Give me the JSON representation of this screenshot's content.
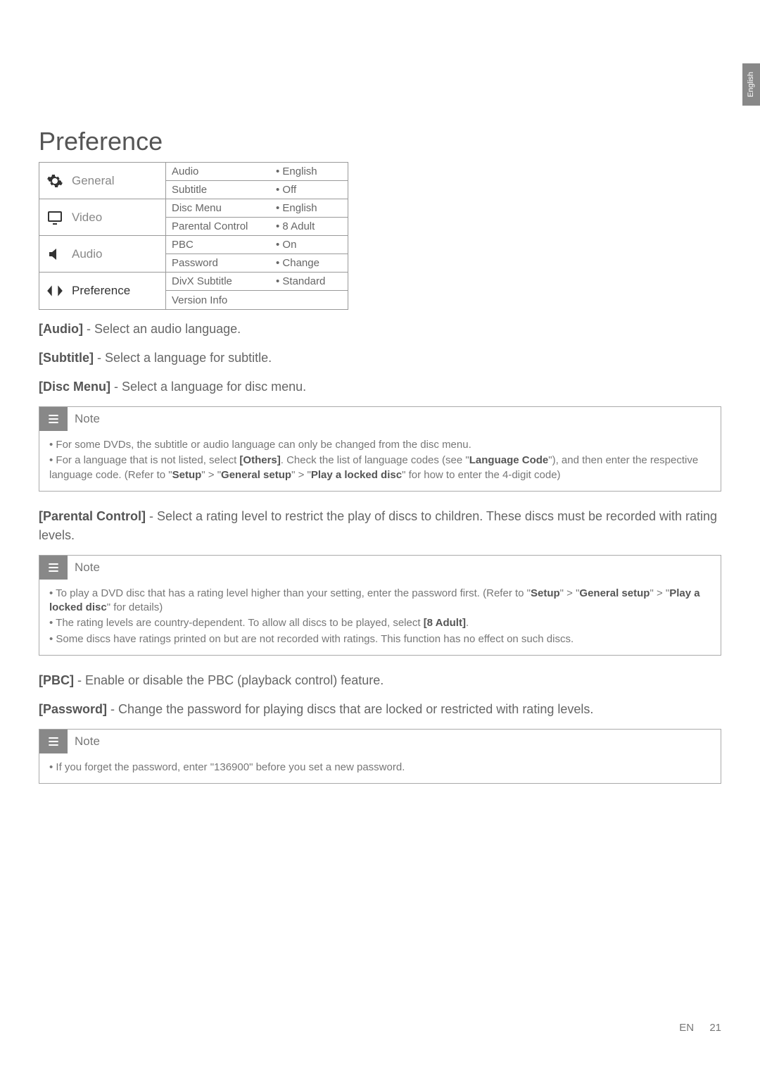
{
  "side_tab": "English",
  "heading": "Preference",
  "menu": {
    "items": [
      "General",
      "Video",
      "Audio",
      "Preference"
    ]
  },
  "table": {
    "rows": [
      {
        "k": "Audio",
        "v": "• English"
      },
      {
        "k": "Subtitle",
        "v": "• Off"
      },
      {
        "k": "Disc Menu",
        "v": "• English"
      },
      {
        "k": "Parental Control",
        "v": "• 8 Adult"
      },
      {
        "k": "PBC",
        "v": "• On"
      },
      {
        "k": "Password",
        "v": "• Change"
      },
      {
        "k": "DivX Subtitle",
        "v": "• Standard"
      },
      {
        "k": "Version Info",
        "v": ""
      }
    ]
  },
  "line_audio": {
    "label": "[Audio]",
    "text": " - Select an audio language."
  },
  "line_subtitle": {
    "label": "[Subtitle]",
    "text": " - Select a language for subtitle."
  },
  "line_discmenu": {
    "label": "[Disc Menu]",
    "text": " - Select a language for disc menu."
  },
  "note1": {
    "title": "Note",
    "b1": "For some DVDs, the subtitle or audio language can only be changed from the disc menu.",
    "b2a": "For a language that is not listed, select ",
    "b2b": "[Others]",
    "b2c": ". Check the list of language codes (see \"",
    "b2d": "Language Code",
    "b2e": "\"), and then enter the respective language code. (Refer to \"",
    "b2f": "Setup",
    "b2g": "\" > \"",
    "b2h": "General setup",
    "b2i": "\" > \"",
    "b2j": "Play a locked disc",
    "b2k": "\" for how to enter the 4-digit code)"
  },
  "line_parental": {
    "label": "[Parental Control]",
    "text": " - Select a rating level to restrict the play of discs to children. These discs must be recorded with rating levels."
  },
  "note2": {
    "title": "Note",
    "b1a": "To play a DVD disc that has a rating level higher than your setting, enter the password first. (Refer to \"",
    "b1b": "Setup",
    "b1c": "\" > \"",
    "b1d": "General setup",
    "b1e": "\" > \"",
    "b1f": "Play a locked disc",
    "b1g": "\" for details)",
    "b2a": "The rating levels are country-dependent. To allow all discs to be played, select ",
    "b2b": "[8 Adult]",
    "b2c": ".",
    "b3": "Some discs have ratings printed on but are not recorded with ratings. This function has no effect on such discs."
  },
  "line_pbc": {
    "label": "[PBC]",
    "text": " - Enable or disable the PBC (playback control) feature."
  },
  "line_password": {
    "label": "[Password]",
    "text": " - Change the password for playing discs that are locked or restricted with rating levels."
  },
  "note3": {
    "title": "Note",
    "b1": "If you forget the password, enter \"136900\" before you set a new password."
  },
  "footer": {
    "en": "EN",
    "page": "21"
  }
}
